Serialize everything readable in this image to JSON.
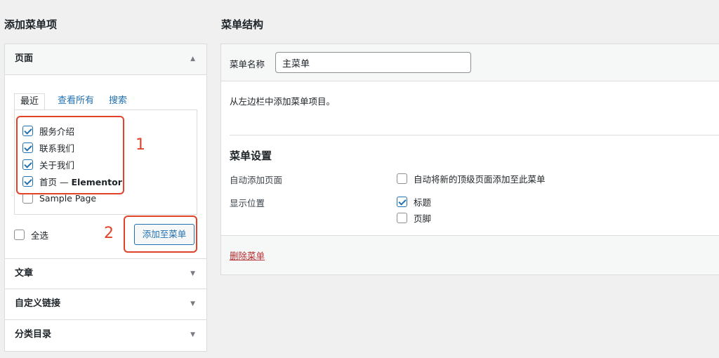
{
  "headings": {
    "add_items": "添加菜单项",
    "structure": "菜单结构"
  },
  "pages_section": {
    "title": "页面",
    "tabs": [
      "最近",
      "查看所有",
      "搜索"
    ],
    "items": [
      {
        "label": "服务介绍",
        "bold_suffix": "",
        "checked": true
      },
      {
        "label": "联系我们",
        "bold_suffix": "",
        "checked": true
      },
      {
        "label": "关于我们",
        "bold_suffix": "",
        "checked": true
      },
      {
        "label": "首页 — ",
        "bold_suffix": "Elementor",
        "checked": true
      },
      {
        "label": "Sample Page",
        "bold_suffix": "",
        "checked": false
      }
    ],
    "select_all": "全选",
    "add_button": "添加至菜单"
  },
  "annotations": {
    "one": "1",
    "two": "2"
  },
  "other_sections": [
    "文章",
    "自定义链接",
    "分类目录"
  ],
  "structure": {
    "menu_name_label": "菜单名称",
    "menu_name_value": "主菜单",
    "hint": "从左边栏中添加菜单项目。",
    "settings_title": "菜单设置",
    "auto_add_label": "自动添加页面",
    "auto_add_option": "自动将新的顶级页面添加至此菜单",
    "location_label": "显示位置",
    "locations": [
      {
        "label": "标题",
        "checked": true
      },
      {
        "label": "页脚",
        "checked": false
      }
    ],
    "delete_link": "删除菜单"
  },
  "colors": {
    "accent": "#2271b1",
    "annotation": "#e0432a",
    "danger": "#b32d2e"
  }
}
